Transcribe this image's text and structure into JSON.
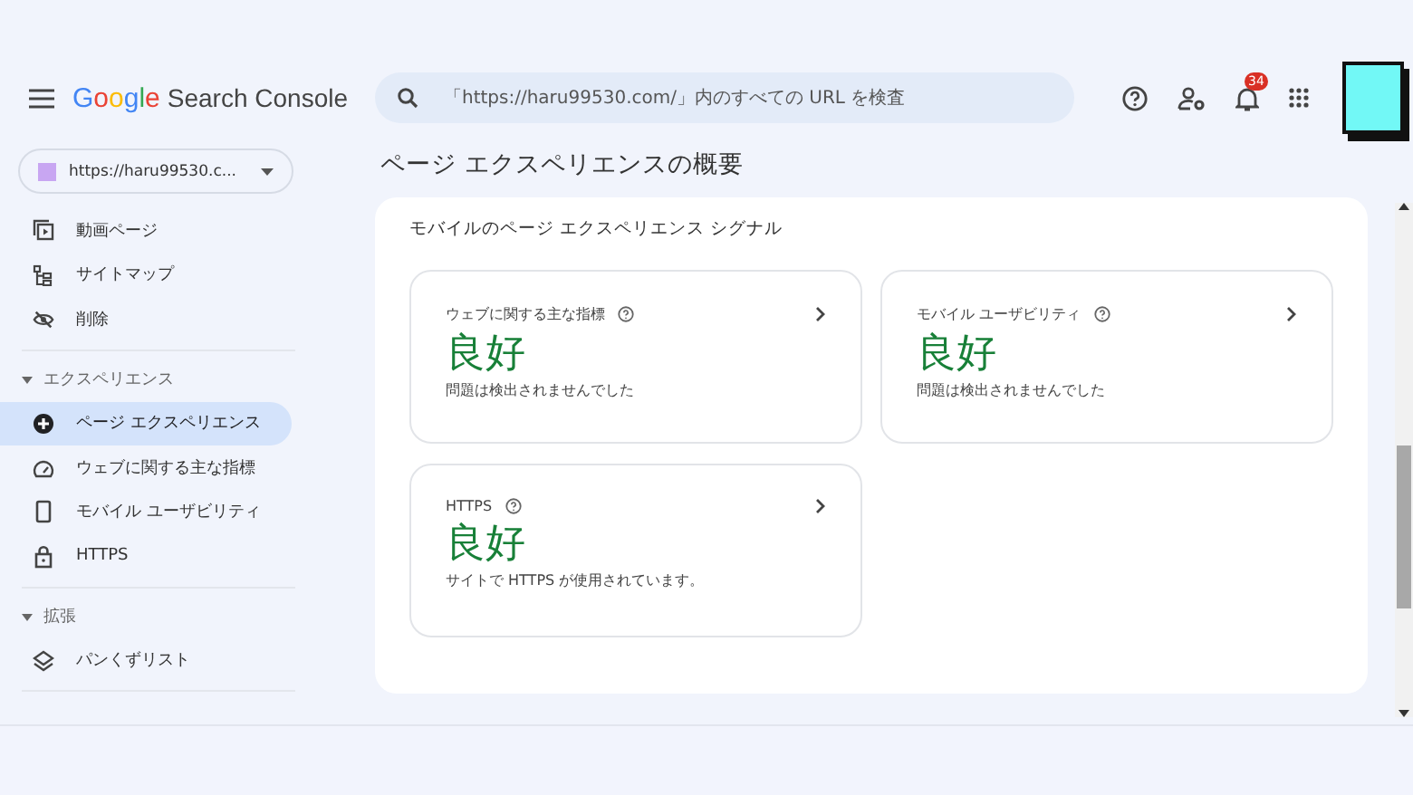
{
  "header": {
    "brand": "Google",
    "product": "Search Console",
    "search": {
      "placeholder": "「https://haru99530.com/」内のすべての URL を検査"
    },
    "notification_count": "34"
  },
  "property": {
    "label": "https://haru99530.c..."
  },
  "sidebar": {
    "sections": [
      {
        "items": [
          {
            "label": "動画ページ",
            "selected": false
          },
          {
            "label": "サイトマップ",
            "selected": false
          },
          {
            "label": "削除",
            "selected": false
          }
        ]
      },
      {
        "title": "エクスペリエンス",
        "expanded": true,
        "items": [
          {
            "label": "ページ エクスペリエンス",
            "selected": true
          },
          {
            "label": "ウェブに関する主な指標",
            "selected": false
          },
          {
            "label": "モバイル ユーザビリティ",
            "selected": false
          },
          {
            "label": "HTTPS",
            "selected": false
          }
        ]
      },
      {
        "title": "拡張",
        "expanded": true,
        "items": [
          {
            "label": "パンくずリスト",
            "selected": false
          }
        ]
      }
    ]
  },
  "page_title": "ページ エクスペリエンスの概要",
  "panel": {
    "title": "モバイルのページ エクスペリエンス シグナル",
    "cards": [
      {
        "title": "ウェブに関する主な指標",
        "status": "良好",
        "description": "問題は検出されませんでした"
      },
      {
        "title": "モバイル ユーザビリティ",
        "status": "良好",
        "description": "問題は検出されませんでした"
      },
      {
        "title": "HTTPS",
        "status": "良好",
        "description": "サイトで HTTPS が使用されています。"
      }
    ]
  }
}
